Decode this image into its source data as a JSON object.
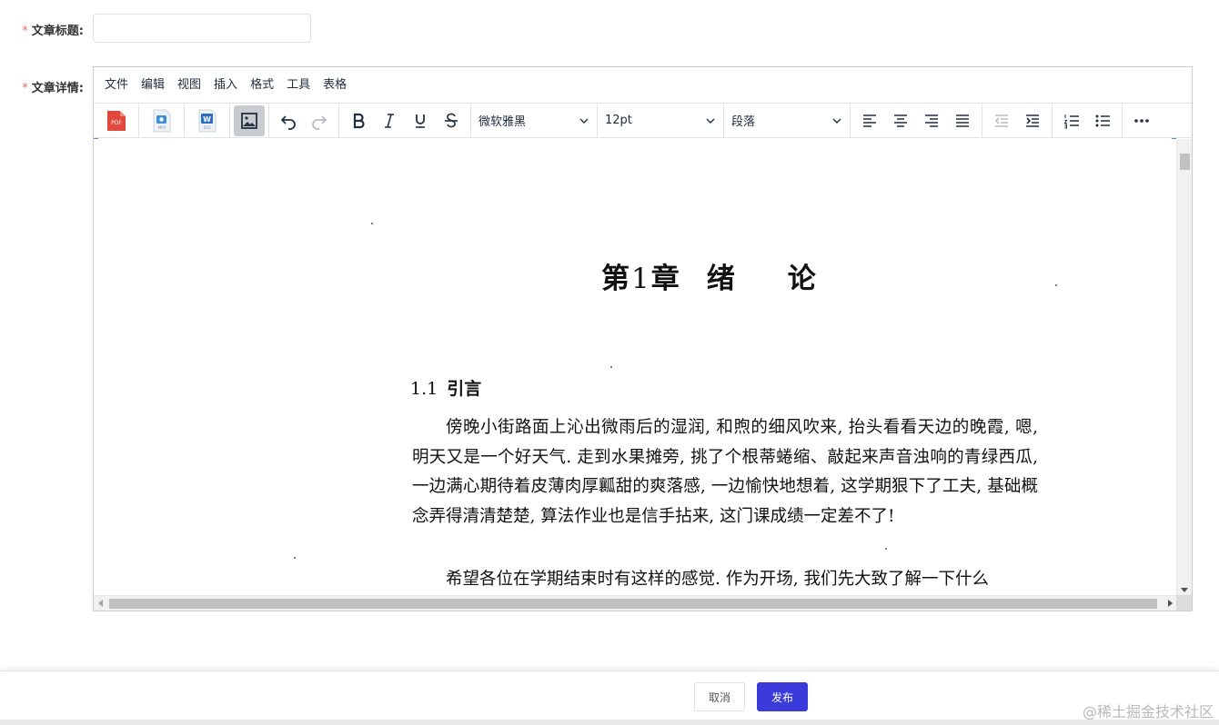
{
  "form": {
    "title_label": "文章标题:",
    "title_value": "",
    "detail_label": "文章详情:",
    "required_mark": "*"
  },
  "editor": {
    "menubar": [
      "文件",
      "编辑",
      "视图",
      "插入",
      "格式",
      "工具",
      "表格"
    ],
    "font_family": "微软雅黑",
    "font_size": "12pt",
    "block_format": "段落",
    "icons": {
      "pdf_label": "PDF",
      "mp4_label": "MP4",
      "doc_label": "DOC",
      "word_glyph": "W"
    }
  },
  "document": {
    "chapter_prefix": "第",
    "chapter_num": "1",
    "chapter_mid": "章",
    "chapter_w1": "绪",
    "chapter_w2": "论",
    "section_num": "1.1",
    "section_title": "引言",
    "paragraph1": "傍晚小街路面上沁出微雨后的湿润, 和煦的细风吹来, 抬头看看天边的晚霞, 嗯, 明天又是一个好天气. 走到水果摊旁, 挑了个根蒂蜷缩、敲起来声音浊响的青绿西瓜, 一边满心期待着皮薄肉厚瓤甜的爽落感, 一边愉快地想着, 这学期狠下了工夫, 基础概念弄得清清楚楚, 算法作业也是信手拈来, 这门课成绩一定差不了!",
    "paragraph2": "希望各位在学期结束时有这样的感觉. 作为开场, 我们先大致了解一下什么"
  },
  "footer": {
    "cancel_label": "取消",
    "publish_label": "发布",
    "watermark": "@稀土掘金技术社区"
  },
  "colors": {
    "primary": "#3b3bdb",
    "required": "#f56c6c",
    "pdf_red": "#e2483d"
  }
}
